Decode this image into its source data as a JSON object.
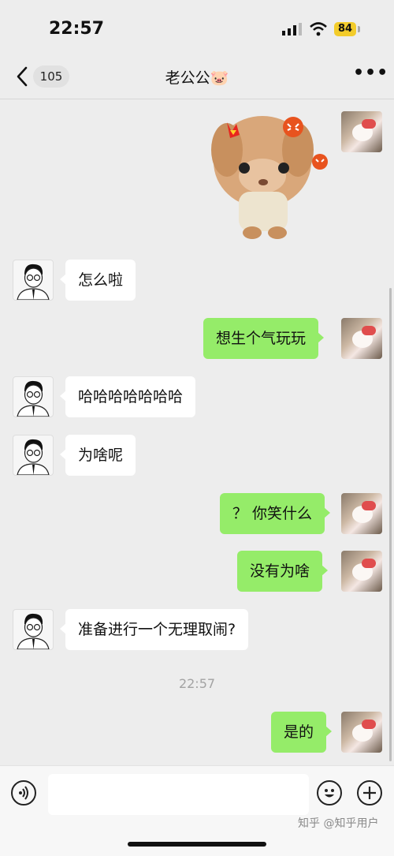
{
  "status_bar": {
    "time": "22:57",
    "battery": "84"
  },
  "nav": {
    "unread_count": "105",
    "title": "老公公🐷"
  },
  "messages": [
    {
      "side": "in",
      "text": "怎么啦"
    },
    {
      "side": "out",
      "text": "想生个气玩玩"
    },
    {
      "side": "in",
      "text": "哈哈哈哈哈哈哈"
    },
    {
      "side": "in",
      "text": "为啥呢"
    },
    {
      "side": "out",
      "text": "？ 你笑什么"
    },
    {
      "side": "out",
      "text": "没有为啥"
    },
    {
      "side": "in",
      "text": "准备进行一个无理取闹?"
    },
    {
      "side": "out",
      "text": "是的"
    }
  ],
  "timestamp": "22:57",
  "watermark": "知乎 @知乎用户",
  "icons": {
    "back": "chevron-left-icon",
    "more": "more-dots-icon",
    "voice": "voice-icon",
    "emoji": "emoji-icon",
    "plus": "plus-icon"
  },
  "colors": {
    "outgoing_bubble": "#95ec69",
    "incoming_bubble": "#ffffff",
    "background": "#ededed",
    "battery": "#f3cc2b"
  }
}
